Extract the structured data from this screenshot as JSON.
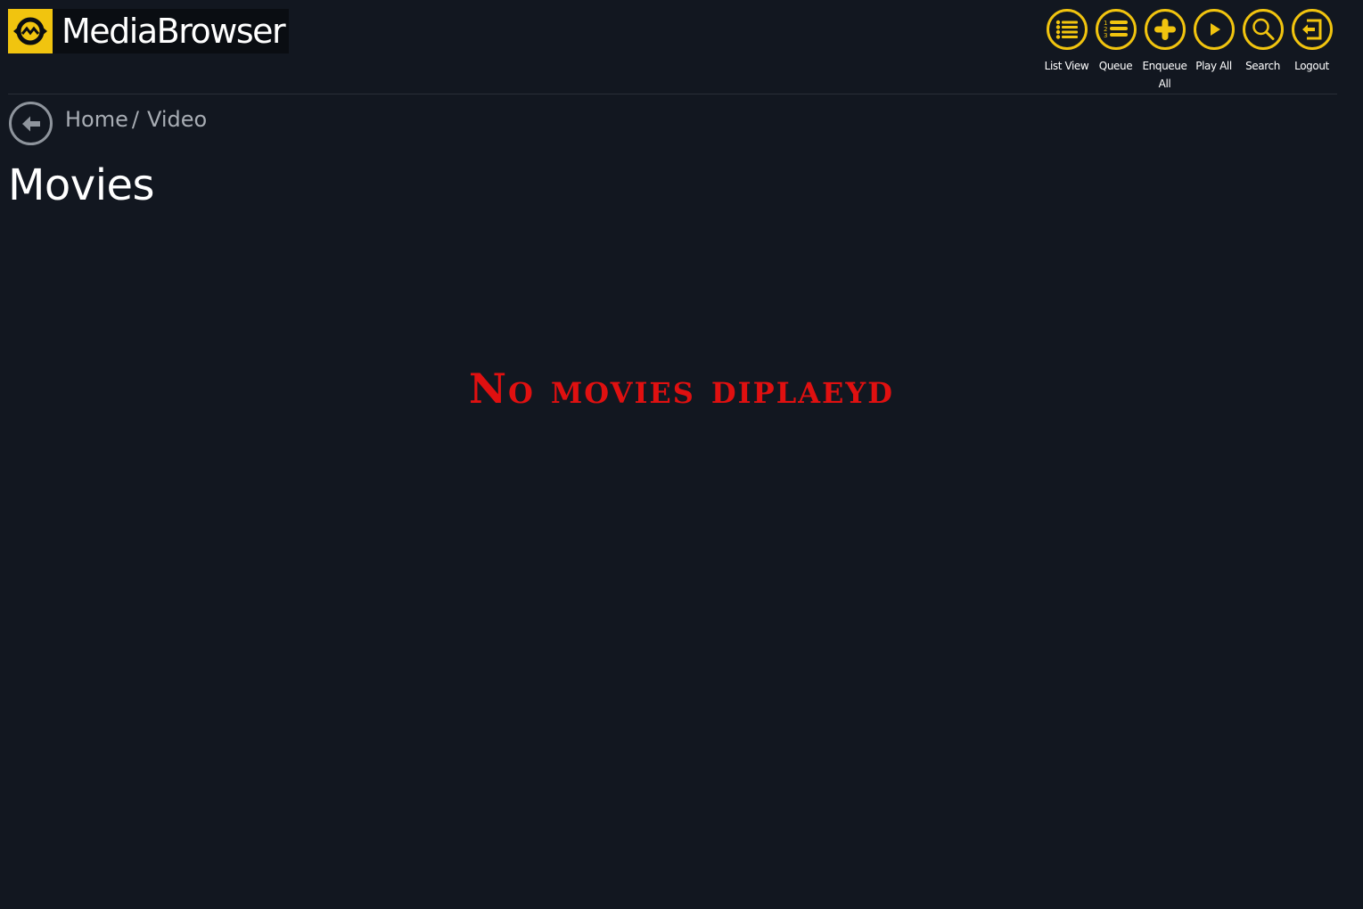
{
  "app": {
    "logo_text": "MediaBrowser",
    "accent_color": "#f1c40f",
    "background_color": "#121720"
  },
  "toolbar": {
    "items": [
      {
        "label": "List View",
        "icon": "list-view-icon"
      },
      {
        "label": "Queue",
        "icon": "queue-icon"
      },
      {
        "label": "Enqueue All",
        "icon": "plus-icon"
      },
      {
        "label": "Play All",
        "icon": "play-icon"
      },
      {
        "label": "Search",
        "icon": "search-icon"
      },
      {
        "label": "Logout",
        "icon": "logout-icon"
      }
    ]
  },
  "breadcrumb": {
    "back_icon": "back-arrow-icon",
    "items": [
      {
        "label": "Home"
      },
      {
        "label": "Video"
      }
    ],
    "separator": "/"
  },
  "main": {
    "title": "Movies",
    "empty_message": "No movies diplaeyd",
    "empty_message_color": "#e01010"
  }
}
